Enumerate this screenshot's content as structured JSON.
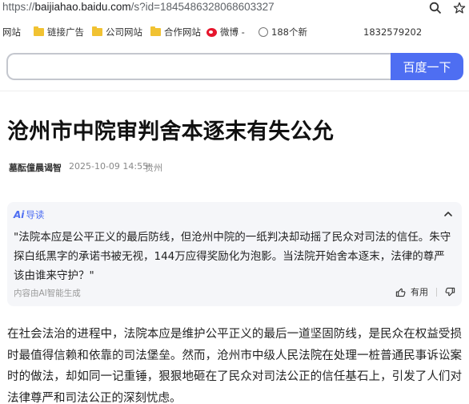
{
  "address_bar": {
    "url_prefix": "https://",
    "url_host": "baijiahao.baidu.com",
    "url_rest": "/s?id=1845486328068603327"
  },
  "bookmarks": [
    {
      "label": "网站",
      "icon": "folder-icon"
    },
    {
      "label": "链接广告",
      "icon": "folder-icon"
    },
    {
      "label": "公司网站",
      "icon": "folder-icon"
    },
    {
      "label": "合作网站",
      "icon": "folder-icon"
    },
    {
      "label": "微博 -",
      "icon": "weibo-icon"
    },
    {
      "label": "188个新",
      "icon": "globe-icon"
    },
    {
      "label": "1832579202",
      "icon": ""
    }
  ],
  "search": {
    "value": "",
    "button_label": "百度一下"
  },
  "article": {
    "title": "沧州市中院审判舍本逐末有失公允",
    "author": "墓酝僮晨谒智",
    "date": "2025-10-09 14:55",
    "location": "贵州",
    "body": "在社会法治的进程中，法院本应是维护公平正义的最后一道坚固防线，是民众在权益受损时最值得信赖和依靠的司法堡垒。然而，沧州市中级人民法院在处理一桩普通民事诉讼案时的做法，却如同一记重锤，狠狠地砸在了民众对司法公正的信任基石上，引发了人们对法律尊严和司法公正的深刻忧虑。"
  },
  "ai_summary": {
    "logo": "Ai",
    "heading": "导读",
    "text": "\"法院本应是公平正义的最后防线，但沧州中院的一纸判决却动摇了民众对司法的信任。朱守探白纸黑字的承诺书被无视，144万应得奖励化为泡影。当法院开始舍本逐末，法律的尊严该由谁来守护？\"",
    "footer": "内容由AI智能生成",
    "useful_label": "有用"
  },
  "colors": {
    "accent": "#4e6ef2",
    "folder": "#f1c232",
    "weibo": "#e6162d"
  }
}
